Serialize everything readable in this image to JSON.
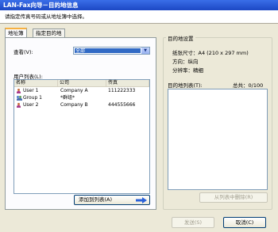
{
  "window": {
    "title": "LAN-Fax向导－目的地信息"
  },
  "instruction": "请指定传真号码或从地址簿中选择。",
  "tabs": [
    {
      "label": "地址簿"
    },
    {
      "label": "指定目的地"
    }
  ],
  "address_book": {
    "view_label": "查看(V):",
    "view_selected": "全部",
    "user_list_label": "用户列表(L):",
    "columns": [
      "名称",
      "公司",
      "传真"
    ],
    "rows": [
      {
        "icon": "user-icon",
        "name": "User 1",
        "company": "Company A",
        "fax": "111222333"
      },
      {
        "icon": "group-icon",
        "name": "Group 1",
        "company": "*群组*",
        "fax": ""
      },
      {
        "icon": "user-icon",
        "name": "User 2",
        "company": "Company B",
        "fax": "444555666"
      }
    ],
    "add_button": "添加到列表(A)"
  },
  "destination_settings": {
    "title": "目的地设置",
    "paper_size_label": "纸张尺寸：",
    "paper_size_value": "A4 (210 x 297 mm)",
    "orientation_label": "方向：",
    "orientation_value": "纵向",
    "resolution_label": "分辨率：",
    "resolution_value": "精细",
    "dest_list_label": "目的地列表(T):",
    "total_label": "总共：",
    "total_value": "0/100",
    "remove_button": "从列表中删除(R)"
  },
  "footer": {
    "send_button": "发送(S)",
    "cancel_button": "取消(C)"
  },
  "colors": {
    "title_bar": "#1c48c4",
    "selection": "#316ac5",
    "arrow": "#2b62d9"
  }
}
